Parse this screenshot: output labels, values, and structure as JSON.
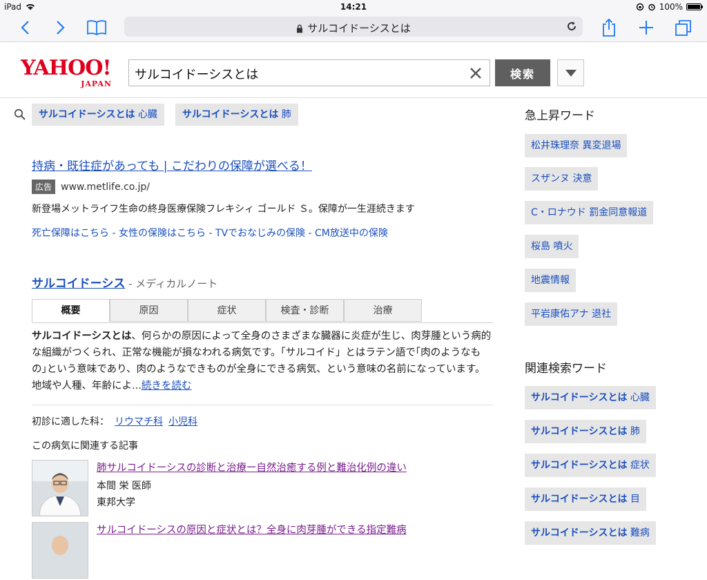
{
  "status": {
    "device": "iPad",
    "time": "14:21",
    "battery": "100%"
  },
  "browser": {
    "url": "サルコイドーシスとは"
  },
  "logo": {
    "main": "YAHOO!",
    "sub": "JAPAN"
  },
  "search": {
    "query": "サルコイドーシスとは",
    "button": "検索"
  },
  "suggest": [
    {
      "bold": "サルコイドーシスとは",
      "rest": " 心臓"
    },
    {
      "bold": "サルコイドーシスとは",
      "rest": " 肺"
    }
  ],
  "ad": {
    "title": "持病・既往症があっても | こだわりの保障が選べる！",
    "badge": "広告",
    "domain": "www.metlife.co.jp/",
    "desc": "新登場メットライフ生命の終身医療保険フレキシィ ゴールド Ｓ。保障が一生涯続きます",
    "links": "死亡保障はこちら - 女性の保険はこちら - TVでおなじみの保険 - CM放送中の保険"
  },
  "result": {
    "title": "サルコイドーシス",
    "source": " - メディカルノート",
    "tabs": [
      "概要",
      "原因",
      "症状",
      "検査・診断",
      "治療"
    ],
    "body_bold": "サルコイドーシスとは",
    "body": "、何らかの原因によって全身のさまざまな臓器に炎症が生じ、肉芽腫という病的な組織がつくられ、正常な機能が損なわれる病気です。「サルコイド」とはラテン語で｢肉のようなもの｣という意味であり、肉のようなできものが全身にできる病気、という意味の名前になっています。地域や人種、年齢によ...",
    "more": "続きを読む",
    "specialty_label": "初診に適した科：",
    "specialties": [
      "リウマチ科",
      "小児科"
    ],
    "related_head": "この病気に関連する記事",
    "articles": [
      {
        "title": "肺サルコイドーシスの診断と治療ー自然治癒する例と難治化例の違い",
        "author": "本間 栄 医師",
        "org": "東邦大学"
      },
      {
        "title": "サルコイドーシスの原因と症状とは？全身に肉芽腫ができる指定難病"
      }
    ]
  },
  "sidebar": {
    "trend_head": "急上昇ワード",
    "trends": [
      "松井珠理奈 異変退場",
      "スザンヌ 決意",
      "C・ロナウド 罰金同意報道",
      "桜島 噴火",
      "地震情報",
      "平岩康佑アナ 退社"
    ],
    "related_head": "関連検索ワード",
    "related": [
      {
        "bold": "サルコイドーシスとは",
        "rest": " 心臓"
      },
      {
        "bold": "サルコイドーシスとは",
        "rest": " 肺"
      },
      {
        "bold": "サルコイドーシスとは",
        "rest": " 症状"
      },
      {
        "bold": "サルコイドーシスとは",
        "rest": " 目"
      },
      {
        "bold": "サルコイドーシスとは",
        "rest": " 難病"
      }
    ]
  }
}
